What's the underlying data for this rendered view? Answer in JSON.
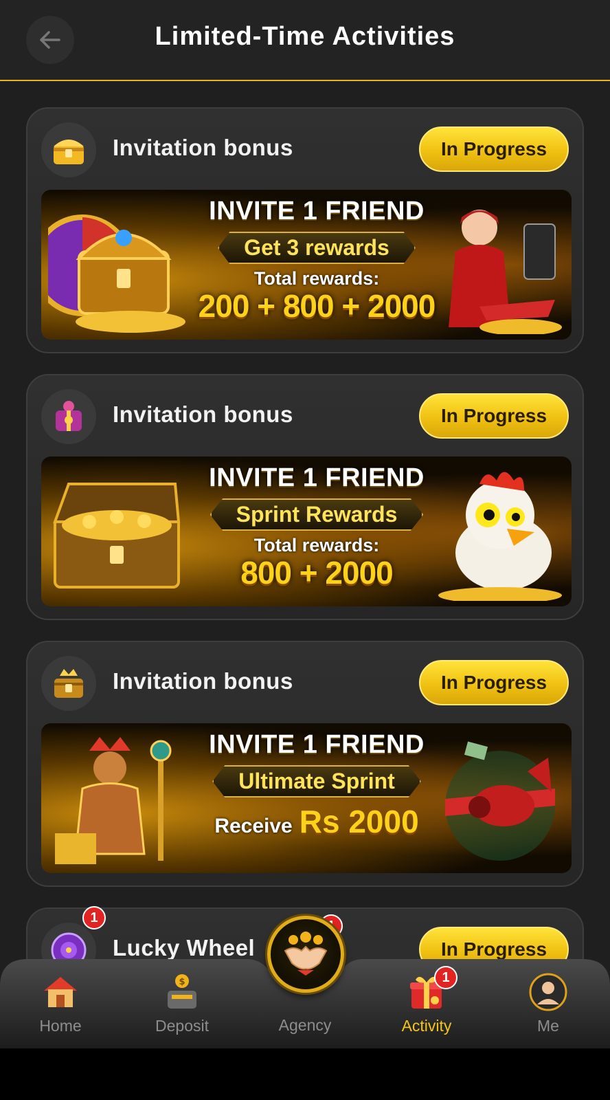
{
  "header": {
    "title": "Limited-Time Activities"
  },
  "cards": [
    {
      "title": "Invitation bonus",
      "status": "In Progress",
      "banner": {
        "headline": "INVITE 1 FRIEND",
        "pill": "Get 3 rewards",
        "sub": "Total rewards:",
        "amount": "200 + 800 + 2000"
      }
    },
    {
      "title": "Invitation bonus",
      "status": "In Progress",
      "banner": {
        "headline": "INVITE 1 FRIEND",
        "pill": "Sprint Rewards",
        "sub": "Total rewards:",
        "amount": "800 + 2000"
      }
    },
    {
      "title": "Invitation bonus",
      "status": "In Progress",
      "banner": {
        "headline": "INVITE 1 FRIEND",
        "pill": "Ultimate Sprint",
        "receive_label": "Receive",
        "receive_amount": "Rs 2000"
      }
    },
    {
      "title": "Lucky Wheel",
      "status": "In Progress",
      "badge": "1"
    }
  ],
  "nav": {
    "items": [
      {
        "label": "Home",
        "icon": "home-icon"
      },
      {
        "label": "Deposit",
        "icon": "deposit-icon"
      },
      {
        "label": "Agency",
        "icon": "handshake-icon",
        "badge": "1"
      },
      {
        "label": "Activity",
        "icon": "gift-icon",
        "badge": "1",
        "active": true
      },
      {
        "label": "Me",
        "icon": "profile-icon"
      }
    ]
  },
  "colors": {
    "accent": "#f4c517",
    "background": "#1f1f1f",
    "badge": "#e32222"
  }
}
